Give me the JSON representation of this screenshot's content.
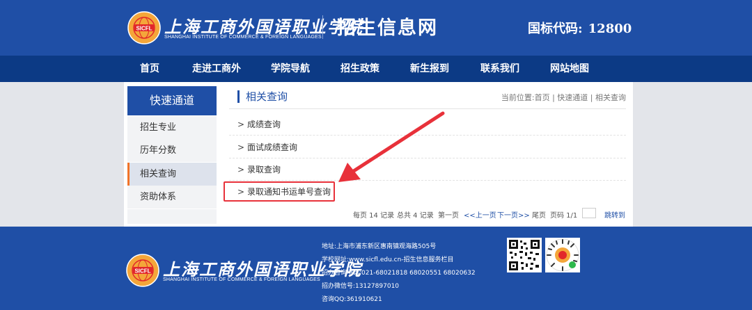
{
  "header": {
    "logo_cn": "上海工商外国语职业学院",
    "logo_en": "SHANGHAI INSTITUTE OF COMMERCE & FOREIGN LANGUAGES",
    "emblem_text": "SICFL",
    "site_name": "招生信息网",
    "code_label": "国标代码:",
    "code_value": "12800"
  },
  "nav": {
    "items": [
      "首页",
      "走进工商外",
      "学院导航",
      "招生政策",
      "新生报到",
      "联系我们",
      "网站地图"
    ]
  },
  "sidebar": {
    "title": "快速通道",
    "items": [
      "招生专业",
      "历年分数",
      "相关查询",
      "资助体系"
    ],
    "active": "相关查询"
  },
  "content": {
    "title": "相关查询",
    "breadcrumb": "当前位置:首页 | 快速通道 | 相关查询",
    "bullet": ">",
    "items": [
      "成绩查询",
      "面试成绩查询",
      "录取查询",
      "录取通知书运单号查询"
    ],
    "highlighted_item": "录取通知书运单号查询"
  },
  "pager": {
    "per_page": "每页 14 记录",
    "total": "总共 4 记录",
    "first": "第一页",
    "prev": "<<上一页",
    "next": "下一页>>",
    "last": "尾页",
    "page_info": "页码 1/1",
    "jump": "跳转到",
    "input_value": ""
  },
  "footer": {
    "address": "地址:上海市浦东新区惠南镇观海路505号",
    "website": "学校网址:www.sicfl.edu.cn-招生信息服务栏目",
    "phone": "招办咨询电话:021-68021818 68020551 68020632",
    "wechat": "招办微信号:13127897010",
    "qq": "咨询QQ:361910621"
  },
  "colors": {
    "header_blue": "#1f4fa6",
    "nav_dark_blue": "#0c3a85",
    "accent_orange": "#f27328",
    "annotation_red": "#e8313a"
  }
}
